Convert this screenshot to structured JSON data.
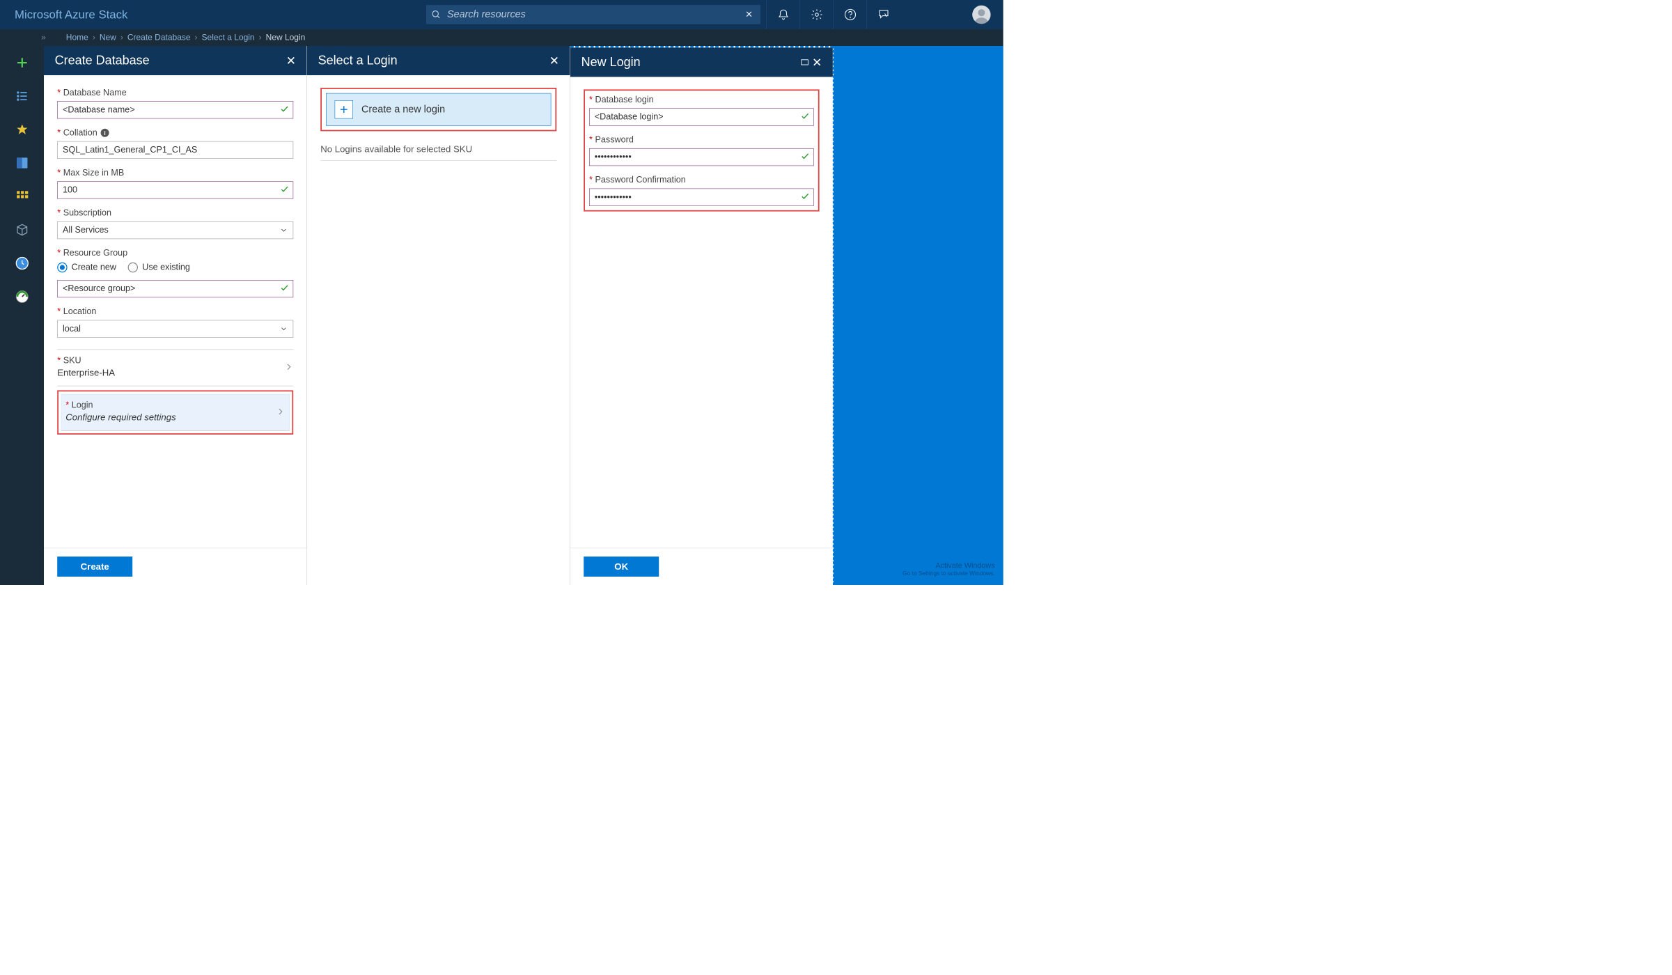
{
  "brand": "Microsoft Azure Stack",
  "search": {
    "placeholder": "Search resources"
  },
  "breadcrumbs": [
    "Home",
    "New",
    "Create Database",
    "Select a Login",
    "New Login"
  ],
  "panel1": {
    "title": "Create Database",
    "fields": {
      "dbname_label": "Database Name",
      "dbname_value": "<Database name>",
      "collation_label": "Collation",
      "collation_value": "SQL_Latin1_General_CP1_CI_AS",
      "maxsize_label": "Max Size in MB",
      "maxsize_value": "100",
      "subscription_label": "Subscription",
      "subscription_value": "All Services",
      "rg_label": "Resource Group",
      "rg_create": "Create new",
      "rg_existing": "Use existing",
      "rg_value": "<Resource group>",
      "location_label": "Location",
      "location_value": "local",
      "sku_label": "SKU",
      "sku_value": "Enterprise-HA",
      "login_label": "Login",
      "login_value": "Configure required settings"
    },
    "create_btn": "Create"
  },
  "panel2": {
    "title": "Select a Login",
    "create_login": "Create a new login",
    "no_logins": "No Logins available for selected SKU"
  },
  "panel3": {
    "title": "New Login",
    "login_label": "Database login",
    "login_value": "<Database login>",
    "password_label": "Password",
    "password_value": "••••••••••••",
    "confirm_label": "Password Confirmation",
    "confirm_value": "••••••••••••",
    "ok_btn": "OK"
  },
  "watermark": {
    "title": "Activate Windows",
    "sub": "Go to Settings to activate Windows."
  }
}
